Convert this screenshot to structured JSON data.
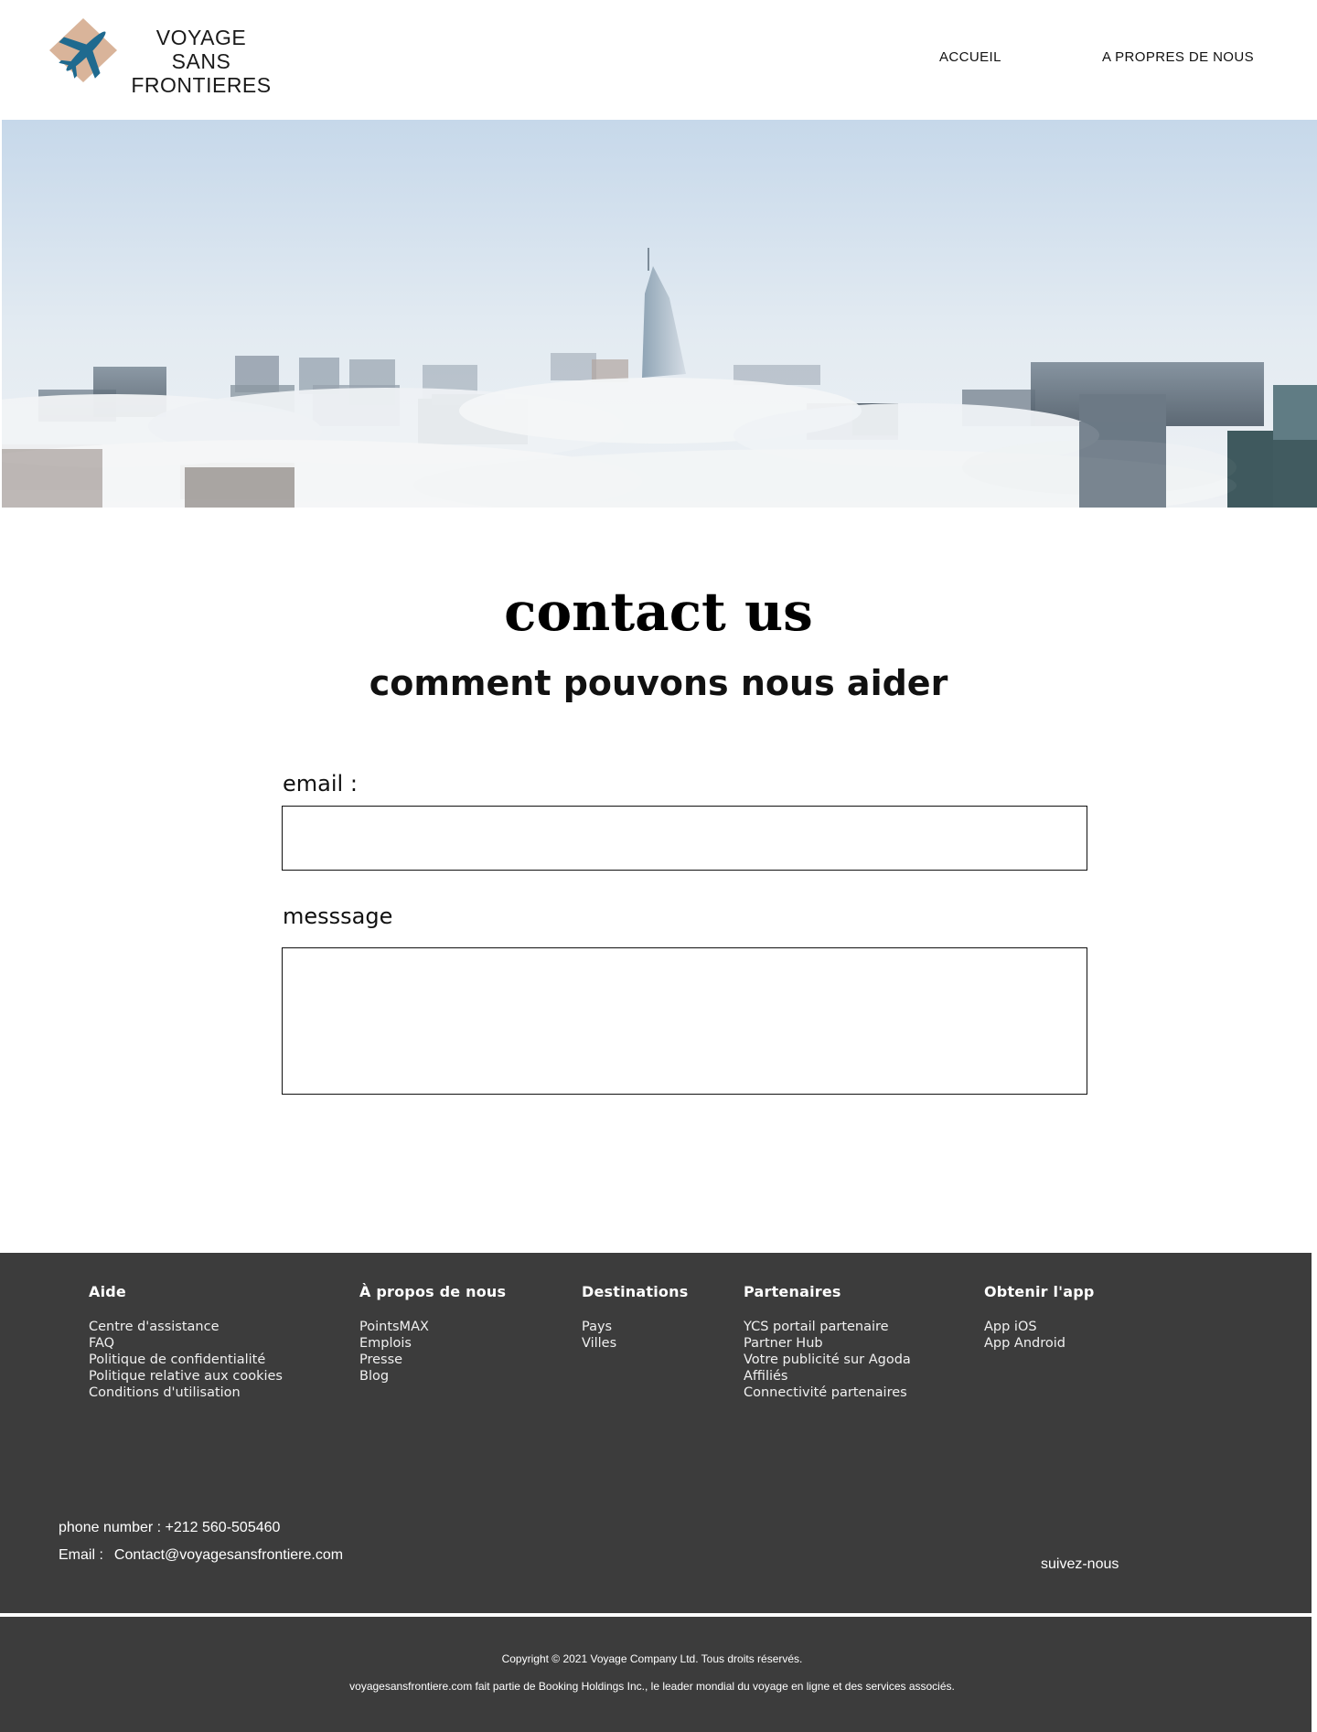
{
  "header": {
    "brand_line1": "VOYAGE SANS",
    "brand_line2": "FRONTIERES",
    "logo_icon": "airplane-icon",
    "nav": [
      {
        "label": "ACCUEIL"
      },
      {
        "label": "A PROPRES DE NOUS"
      }
    ]
  },
  "hero": {
    "image": "city-skyline-above-clouds"
  },
  "contact": {
    "title": "contact us",
    "subtitle": "comment pouvons nous aider",
    "email_label": "email  :",
    "message_label": "messsage",
    "email_value": "",
    "message_value": ""
  },
  "footer": {
    "columns": [
      {
        "heading": "Aide",
        "items": [
          "Centre d'assistance",
          "FAQ",
          "Politique de confidentialité",
          "Politique relative aux cookies",
          "Conditions d'utilisation"
        ]
      },
      {
        "heading": "À propos de nous",
        "items": [
          "PointsMAX",
          "Emplois",
          "Presse",
          "Blog"
        ]
      },
      {
        "heading": "Destinations",
        "items": [
          "Pays",
          "Villes"
        ]
      },
      {
        "heading": "Partenaires",
        "items": [
          "YCS portail partenaire",
          "Partner Hub",
          "Votre publicité sur Agoda",
          "Affiliés",
          "Connectivité partenaires"
        ]
      },
      {
        "heading": "Obtenir l'app",
        "items": [
          "App iOS",
          "App Android"
        ]
      }
    ],
    "phone": "phone number : +212 560-505460",
    "email_label": "Email :",
    "email_value": "Contact@voyagesansfrontiere.com",
    "follow": "suivez-nous",
    "copyright": "Copyright © 2021 Voyage Company Ltd. Tous droits réservés.",
    "legal": "voyagesansfrontiere.com fait partie de Booking Holdings Inc., le leader mondial du voyage en ligne et des services associés."
  },
  "colors": {
    "logo_diamond": "#d9b49a",
    "logo_plane": "#1f6a8f",
    "footer_bg": "#3c3c3c",
    "text": "#111111"
  }
}
